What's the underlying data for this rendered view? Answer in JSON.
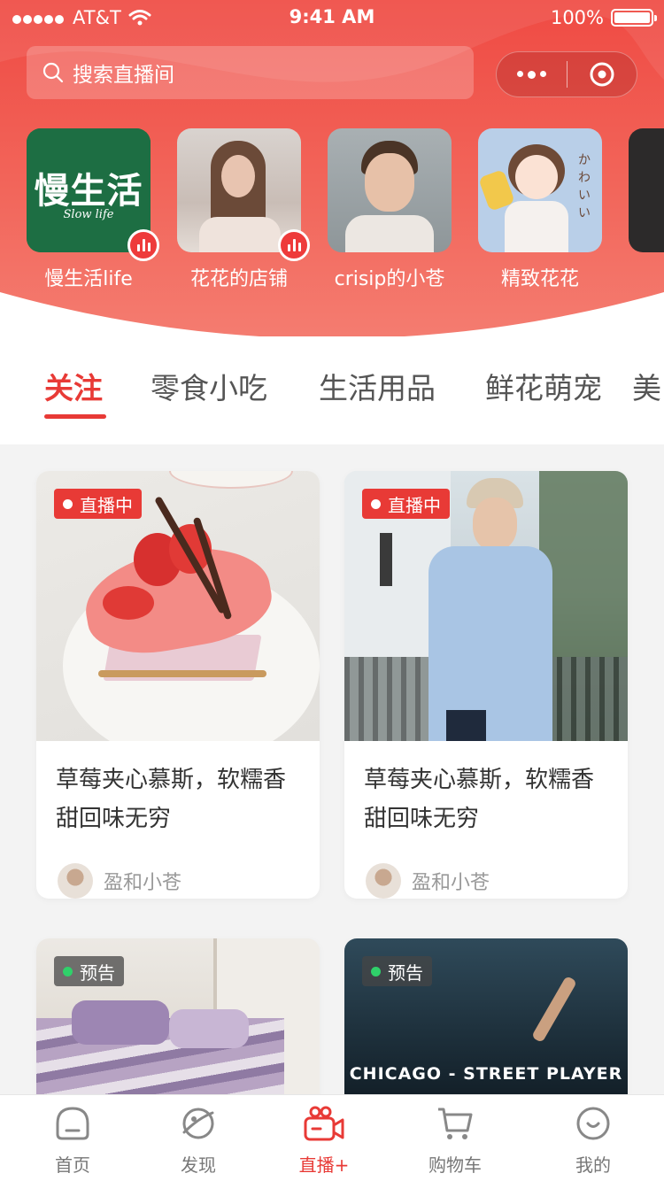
{
  "colors": {
    "accent": "#e83a36",
    "hero": "#ef4a43",
    "live_dot": "#ffffff",
    "preview_dot": "#2fd16a"
  },
  "status": {
    "carrier": "AT&T",
    "time": "9:41 AM",
    "battery": "100%"
  },
  "search": {
    "placeholder": "搜索直播间",
    "icon": "search-icon"
  },
  "capsule": {
    "more_icon": "more-dots-icon",
    "close_icon": "target-icon"
  },
  "stories": [
    {
      "name": "慢生活life",
      "logo_text": "慢生活",
      "logo_sub": "Slow life",
      "live": true
    },
    {
      "name": "花花的店铺",
      "live": true
    },
    {
      "name": "crisip的小苍",
      "live": false
    },
    {
      "name": "精致花花",
      "live": false
    }
  ],
  "tabs": [
    {
      "label": "关注",
      "active": true
    },
    {
      "label": "零食小吃",
      "active": false
    },
    {
      "label": "生活用品",
      "active": false
    },
    {
      "label": "鲜花萌宠",
      "active": false
    },
    {
      "label": "美",
      "active": false
    }
  ],
  "cards": [
    {
      "badge": "直播中",
      "badge_type": "live",
      "title": "草莓夹心慕斯，软糯香甜回味无穷",
      "author": "盈和小苍"
    },
    {
      "badge": "直播中",
      "badge_type": "live",
      "title": "草莓夹心慕斯，软糯香甜回味无穷",
      "author": "盈和小苍"
    },
    {
      "badge": "预告",
      "badge_type": "preview",
      "title": "",
      "author": ""
    },
    {
      "badge": "预告",
      "badge_type": "preview",
      "title": "",
      "author": "",
      "overlay": "CHICAGO - STREET PLAYER"
    }
  ],
  "tabbar": [
    {
      "label": "首页",
      "icon": "home-icon",
      "active": false
    },
    {
      "label": "发现",
      "icon": "planet-icon",
      "active": false
    },
    {
      "label": "直播+",
      "icon": "video-camera-icon",
      "active": true
    },
    {
      "label": "购物车",
      "icon": "cart-icon",
      "active": false
    },
    {
      "label": "我的",
      "icon": "smile-icon",
      "active": false
    }
  ]
}
